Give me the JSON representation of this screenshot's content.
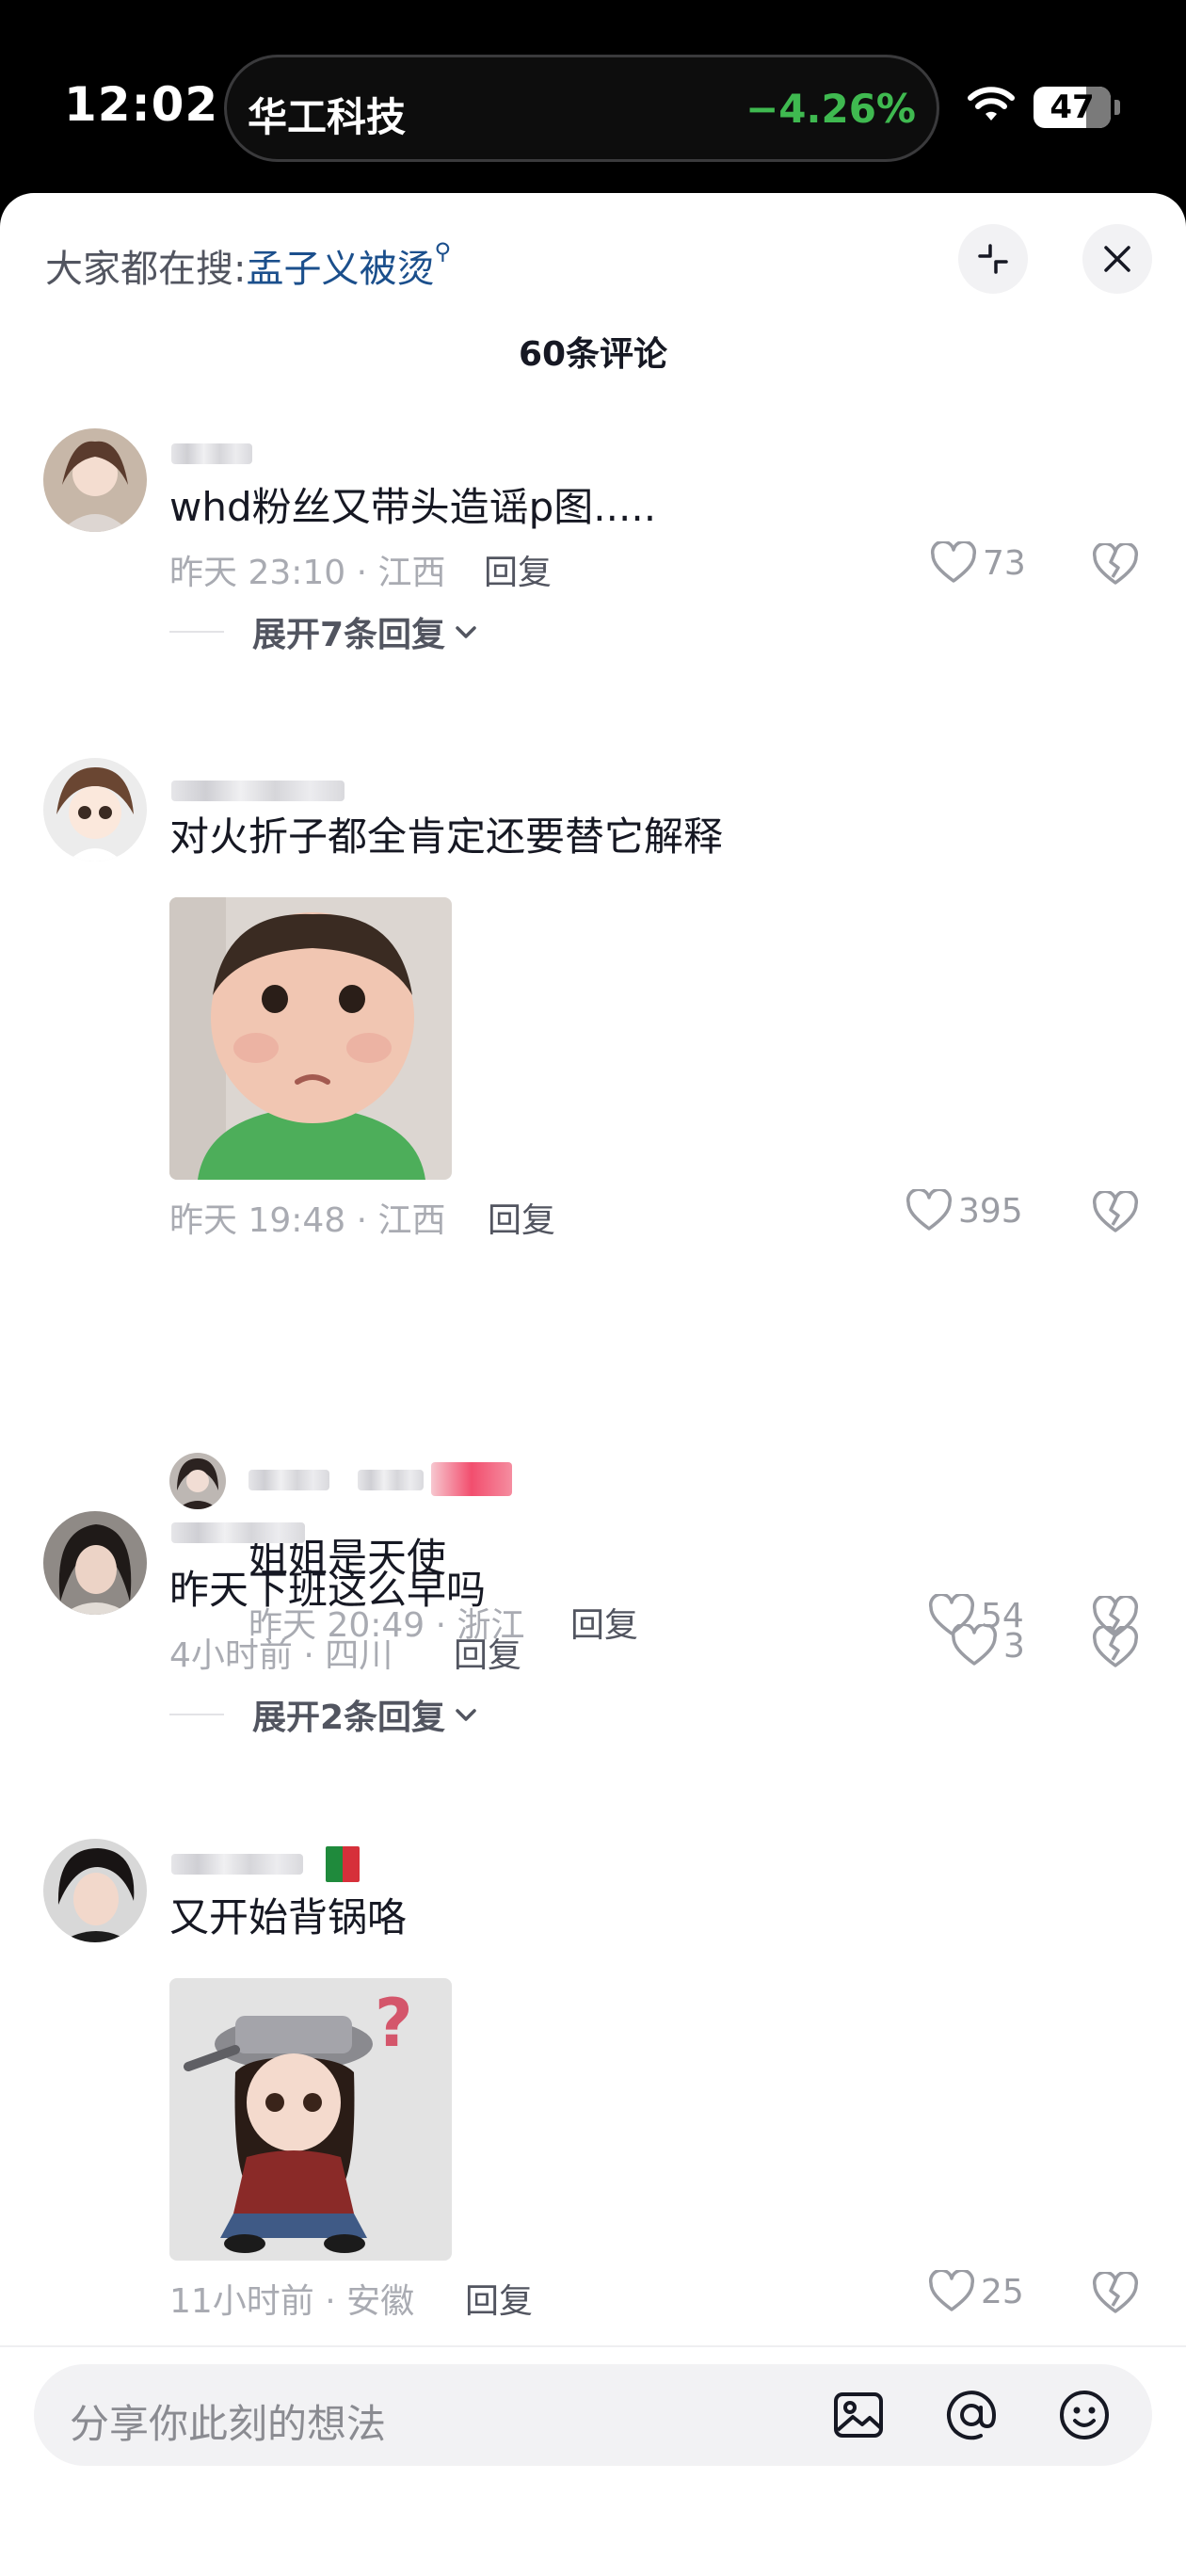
{
  "status": {
    "time": "12:02",
    "stock_name": "华工科技",
    "stock_change": "−4.26%",
    "battery": "47",
    "stock_color": "#3fb950"
  },
  "header": {
    "search_label": "大家都在搜:",
    "search_keyword": "孟子义被烫",
    "search_icon": "search-icon",
    "collapse_icon": "collapse-arrows-icon",
    "close_icon": "close-icon",
    "comment_count": "60条评论"
  },
  "comments": [
    {
      "text": "whd粉丝又带头造谣p图.....",
      "time_location": "昨天 23:10 · 江西",
      "reply_label": "回复",
      "likes": "73",
      "expand_label": "展开7条回复"
    },
    {
      "text": "对火折子都全肯定还要替它解释",
      "time_location": "昨天 19:48 · 江西",
      "reply_label": "回复",
      "likes": "395",
      "image": "sad-toddler-sticker"
    },
    {
      "text": "姐姐是天使",
      "time_location": "昨天 20:49 · 浙江",
      "reply_label": "回复",
      "likes": "54"
    },
    {
      "text": "昨天下班这么早吗",
      "time_location": "4小时前 · 四川",
      "reply_label": "回复",
      "likes": "3",
      "expand_label": "展开2条回复"
    },
    {
      "text": "又开始背锅咯",
      "time_location": "11小时前 · 安徽",
      "reply_label": "回复",
      "likes": "25",
      "image": "girl-with-pot-sticker"
    }
  ],
  "input": {
    "placeholder": "分享你此刻的想法",
    "image_icon": "image-icon",
    "mention_icon": "at-mention-icon",
    "emoji_icon": "emoji-icon"
  },
  "colors": {
    "keyword": "#1b4f8c",
    "meta": "#a9abb2",
    "text": "#161823"
  }
}
